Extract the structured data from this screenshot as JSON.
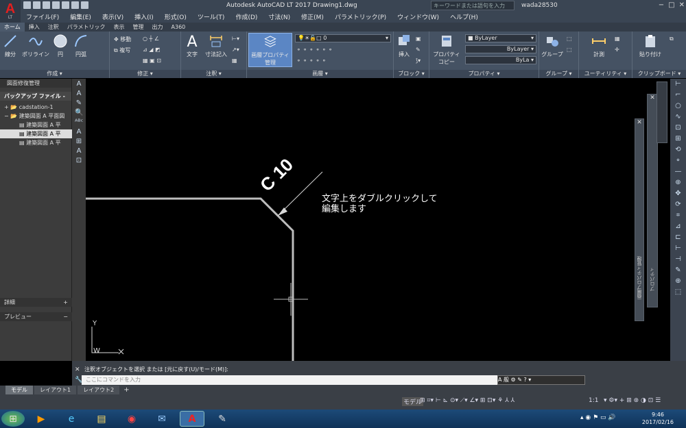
{
  "titlebar": {
    "title": "Autodesk AutoCAD LT 2017    Drawing1.dwg",
    "search_placeholder": "キーワードまたは語句を入力",
    "username": "wada28530",
    "app_letter": "A",
    "app_sub": "LT"
  },
  "menubar": [
    "ファイル(F)",
    "編集(E)",
    "表示(V)",
    "挿入(I)",
    "形式(O)",
    "ツール(T)",
    "作成(D)",
    "寸法(N)",
    "修正(M)",
    "パラメトリック(P)",
    "ウィンドウ(W)",
    "ヘルプ(H)"
  ],
  "ribbon_tabs": [
    "ホーム",
    "挿入",
    "注釈",
    "パラメトリック",
    "表示",
    "管理",
    "出力",
    "A360"
  ],
  "ribbon": {
    "create": {
      "line": "線分",
      "polyline": "ポリライン",
      "circle": "円",
      "arc": "円弧",
      "title": "作成 ▾"
    },
    "modify": {
      "move": "移動",
      "copy": "複写",
      "title": "修正 ▾"
    },
    "annotation": {
      "text": "文字",
      "dim": "寸法記入",
      "title": "注釈 ▾"
    },
    "layers": {
      "manager": "画層プロパティ管理",
      "current_layer": "0",
      "title": "画層 ▾"
    },
    "block": {
      "insert": "挿入",
      "title": "ブロック ▾"
    },
    "properties": {
      "copy": "プロパティコピー",
      "color": "ByLayer",
      "linetype": "ByLayer",
      "lineweight": "ByLa",
      "title": "プロパティ ▾"
    },
    "groups": {
      "group": "グループ",
      "title": "グループ ▾"
    },
    "utilities": {
      "measure": "計測",
      "title": "ユーティリティ ▾"
    },
    "clipboard": {
      "paste": "貼り付け",
      "title": "クリップボード ▾"
    }
  },
  "left_panel": {
    "header": "図面修復管理",
    "sub": "バックアップ ファイル -",
    "tree": [
      {
        "label": "cadstation-1",
        "level": 0,
        "toggle": "+"
      },
      {
        "label": "建築図面 A    平面図",
        "level": 0,
        "toggle": "−"
      },
      {
        "label": "建築図面 A    平",
        "level": 1,
        "toggle": ""
      },
      {
        "label": "建築図面 A    平",
        "level": 1,
        "toggle": ""
      },
      {
        "label": "建築図面 A    平",
        "level": 1,
        "toggle": ""
      }
    ],
    "details": "詳細",
    "details_btn": "+",
    "preview": "プレビュー",
    "preview_btn": "−"
  },
  "canvas": {
    "dim_text": "C 10",
    "note_line1": "文字上をダブルクリックして",
    "note_line2": "編集します",
    "ucs_y": "Y",
    "ucs_w": "W"
  },
  "palettes": {
    "layer_props": "画層プロパティ管理",
    "properties": "プロパティ"
  },
  "command": {
    "history": "注釈オブジェクトを選択 または [元に戻す(U)/モード(M)]:",
    "placeholder": "ここにコマンドを入力",
    "ime": "A 般"
  },
  "layout_tabs": [
    "モデル",
    "レイアウト1",
    "レイアウト2"
  ],
  "statusbar": {
    "model": "モデル",
    "scale": "1:1"
  },
  "taskbar": {
    "time": "9:46",
    "date": "2017/02/16"
  }
}
